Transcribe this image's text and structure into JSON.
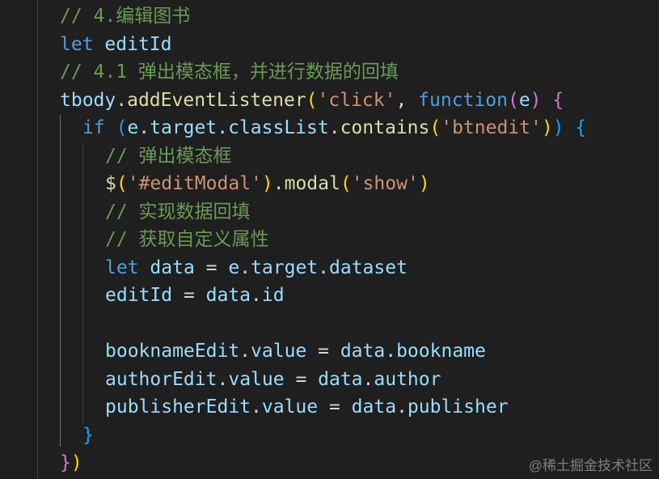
{
  "editor": {
    "theme_colors": {
      "background": "#1f1f1f",
      "comment": "#6a9955",
      "keyword": "#569cd6",
      "variable": "#9cdcfe",
      "method": "#dcdcaa",
      "string": "#ce9178",
      "bracket_gold": "#ffd700",
      "bracket_purple": "#da70d6",
      "bracket_blue": "#179fff"
    },
    "lines": [
      {
        "tokens": [
          {
            "t": "// 4.编辑图书",
            "c": "comment"
          }
        ]
      },
      {
        "tokens": [
          {
            "t": "let",
            "c": "keyword"
          },
          {
            "t": " ",
            "c": "plain"
          },
          {
            "t": "editId",
            "c": "var"
          }
        ]
      },
      {
        "tokens": [
          {
            "t": "// 4.1 弹出模态框，并进行数据的回填",
            "c": "comment"
          }
        ]
      },
      {
        "tokens": [
          {
            "t": "tbody",
            "c": "var"
          },
          {
            "t": ".",
            "c": "plain"
          },
          {
            "t": "addEventListener",
            "c": "method"
          },
          {
            "t": "(",
            "c": "paren1"
          },
          {
            "t": "'click'",
            "c": "string"
          },
          {
            "t": ", ",
            "c": "plain"
          },
          {
            "t": "function",
            "c": "keyword"
          },
          {
            "t": "(",
            "c": "paren2"
          },
          {
            "t": "e",
            "c": "var"
          },
          {
            "t": ")",
            "c": "paren2"
          },
          {
            "t": " ",
            "c": "plain"
          },
          {
            "t": "{",
            "c": "paren2"
          }
        ]
      },
      {
        "tokens": [
          {
            "t": "if",
            "c": "keyword"
          },
          {
            "t": " ",
            "c": "plain"
          },
          {
            "t": "(",
            "c": "paren3"
          },
          {
            "t": "e",
            "c": "var"
          },
          {
            "t": ".",
            "c": "plain"
          },
          {
            "t": "target",
            "c": "var"
          },
          {
            "t": ".",
            "c": "plain"
          },
          {
            "t": "classList",
            "c": "var"
          },
          {
            "t": ".",
            "c": "plain"
          },
          {
            "t": "contains",
            "c": "method"
          },
          {
            "t": "(",
            "c": "paren1"
          },
          {
            "t": "'btnedit'",
            "c": "string"
          },
          {
            "t": ")",
            "c": "paren1"
          },
          {
            "t": ")",
            "c": "paren3"
          },
          {
            "t": " ",
            "c": "plain"
          },
          {
            "t": "{",
            "c": "paren3"
          }
        ]
      },
      {
        "tokens": [
          {
            "t": "// 弹出模态框",
            "c": "comment"
          }
        ]
      },
      {
        "tokens": [
          {
            "t": "$",
            "c": "method"
          },
          {
            "t": "(",
            "c": "paren1"
          },
          {
            "t": "'#editModal'",
            "c": "string"
          },
          {
            "t": ")",
            "c": "paren1"
          },
          {
            "t": ".",
            "c": "plain"
          },
          {
            "t": "modal",
            "c": "method"
          },
          {
            "t": "(",
            "c": "paren1"
          },
          {
            "t": "'show'",
            "c": "string"
          },
          {
            "t": ")",
            "c": "paren1"
          }
        ]
      },
      {
        "tokens": [
          {
            "t": "// 实现数据回填",
            "c": "comment"
          }
        ]
      },
      {
        "tokens": [
          {
            "t": "// 获取自定义属性",
            "c": "comment"
          }
        ]
      },
      {
        "tokens": [
          {
            "t": "let",
            "c": "keyword"
          },
          {
            "t": " ",
            "c": "plain"
          },
          {
            "t": "data",
            "c": "var"
          },
          {
            "t": " = ",
            "c": "plain"
          },
          {
            "t": "e",
            "c": "var"
          },
          {
            "t": ".",
            "c": "plain"
          },
          {
            "t": "target",
            "c": "var"
          },
          {
            "t": ".",
            "c": "plain"
          },
          {
            "t": "dataset",
            "c": "var"
          }
        ]
      },
      {
        "tokens": [
          {
            "t": "editId",
            "c": "var"
          },
          {
            "t": " = ",
            "c": "plain"
          },
          {
            "t": "data",
            "c": "var"
          },
          {
            "t": ".",
            "c": "plain"
          },
          {
            "t": "id",
            "c": "var"
          }
        ]
      },
      {
        "tokens": []
      },
      {
        "tokens": [
          {
            "t": "booknameEdit",
            "c": "var"
          },
          {
            "t": ".",
            "c": "plain"
          },
          {
            "t": "value",
            "c": "var"
          },
          {
            "t": " = ",
            "c": "plain"
          },
          {
            "t": "data",
            "c": "var"
          },
          {
            "t": ".",
            "c": "plain"
          },
          {
            "t": "bookname",
            "c": "var"
          }
        ]
      },
      {
        "tokens": [
          {
            "t": "authorEdit",
            "c": "var"
          },
          {
            "t": ".",
            "c": "plain"
          },
          {
            "t": "value",
            "c": "var"
          },
          {
            "t": " = ",
            "c": "plain"
          },
          {
            "t": "data",
            "c": "var"
          },
          {
            "t": ".",
            "c": "plain"
          },
          {
            "t": "author",
            "c": "var"
          }
        ]
      },
      {
        "tokens": [
          {
            "t": "publisherEdit",
            "c": "var"
          },
          {
            "t": ".",
            "c": "plain"
          },
          {
            "t": "value",
            "c": "var"
          },
          {
            "t": " = ",
            "c": "plain"
          },
          {
            "t": "data",
            "c": "var"
          },
          {
            "t": ".",
            "c": "plain"
          },
          {
            "t": "publisher",
            "c": "var"
          }
        ]
      },
      {
        "tokens": [
          {
            "t": "}",
            "c": "paren3"
          }
        ]
      },
      {
        "tokens": [
          {
            "t": "}",
            "c": "paren2"
          },
          {
            "t": ")",
            "c": "paren1"
          }
        ]
      }
    ]
  },
  "watermark": "@稀土掘金技术社区"
}
